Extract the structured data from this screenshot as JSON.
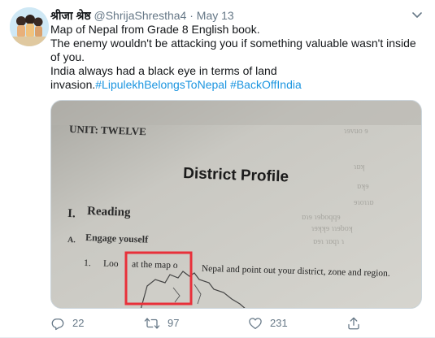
{
  "tweet": {
    "author_name": "श्रीजा श्रेष्ठ",
    "handle": "@ShrijaShrestha4",
    "separator": "·",
    "time": "May 13",
    "lines": [
      "Map of Nepal from Grade 8 English book.",
      "The enemy wouldn't be attacking you if something valuable wasn't inside of you.",
      "India always had a black eye in terms of  land invasion."
    ],
    "hashtags": [
      "#LipulekhBelongsToNepal",
      "#BackOffIndia"
    ]
  },
  "photo": {
    "unit_heading": "UNIT: TWELVE",
    "title": "District Profile",
    "section_number": "I.",
    "section_title": "Reading",
    "sub_letter": "A.",
    "sub_title": "Engage youself",
    "item_number": "1.",
    "item_text_a": "Loo",
    "item_text_b": "at the map o",
    "item_text_c": "Nepal and point out your district, zone and region."
  },
  "actions": {
    "replies": "22",
    "retweets": "97",
    "likes": "231"
  },
  "colors": {
    "link": "#1b95e0",
    "meta": "#657786",
    "highlight_box": "#e8303a"
  }
}
